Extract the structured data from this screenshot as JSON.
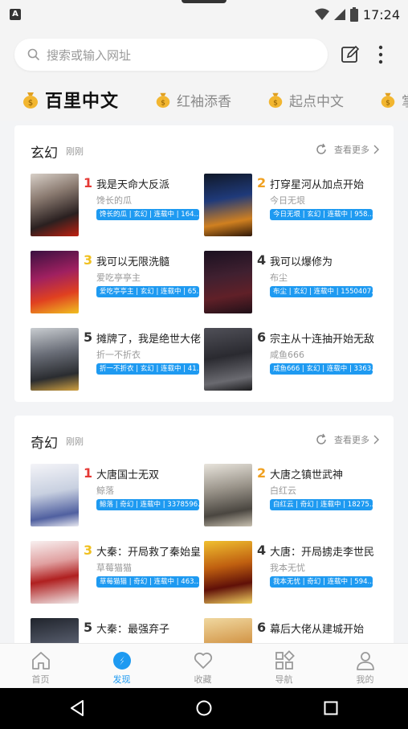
{
  "status": {
    "time": "17:24",
    "app_icon": "A"
  },
  "search": {
    "placeholder": "搜索或输入网址"
  },
  "channels": [
    {
      "label": "百里中文",
      "active": true
    },
    {
      "label": "红袖添香",
      "active": false
    },
    {
      "label": "起点中文",
      "active": false
    },
    {
      "label": "掌",
      "active": false
    }
  ],
  "sections": [
    {
      "title": "玄幻",
      "subtitle": "刚刚",
      "more_label": "查看更多",
      "books": [
        {
          "rank": "1",
          "title": "我是天命大反派",
          "author": "馋长的瓜",
          "tag": "馋长的瓜 | 玄幻 | 连载中 | 164..."
        },
        {
          "rank": "2",
          "title": "打穿星河从加点开始",
          "author": "今日无垠",
          "tag": "今日无垠 | 玄幻 | 连载中 | 958..."
        },
        {
          "rank": "3",
          "title": "我可以无限洗髓",
          "author": "爱吃亭亭主",
          "tag": "爱吃亭亭主 | 玄幻 | 连载中 | 65..."
        },
        {
          "rank": "4",
          "title": "我可以爆修为",
          "author": "布尘",
          "tag": "布尘 | 玄幻 | 连载中 | 1550407..."
        },
        {
          "rank": "5",
          "title": "摊牌了，我是绝世大佬",
          "author": "折一不折衣",
          "tag": "折一不折衣 | 玄幻 | 连载中 | 41..."
        },
        {
          "rank": "6",
          "title": "宗主从十连抽开始无敌",
          "author": "咸鱼666",
          "tag": "咸鱼666 | 玄幻 | 连载中 | 3363..."
        }
      ]
    },
    {
      "title": "奇幻",
      "subtitle": "刚刚",
      "more_label": "查看更多",
      "books": [
        {
          "rank": "1",
          "title": "大唐国士无双",
          "author": "鲸落",
          "tag": "鲸落 | 奇幻 | 连载中 | 3378596..."
        },
        {
          "rank": "2",
          "title": "大唐之镇世武神",
          "author": "白红云",
          "tag": "白红云 | 奇幻 | 连载中 | 18275..."
        },
        {
          "rank": "3",
          "title": "大秦：开局救了秦始皇",
          "author": "草莓猫猫",
          "tag": "草莓猫猫 | 奇幻 | 连载中 | 463..."
        },
        {
          "rank": "4",
          "title": "大唐：开局掳走李世民",
          "author": "我本无忧",
          "tag": "我本无忧 | 奇幻 | 连载中 | 594..."
        },
        {
          "rank": "5",
          "title": "大秦：最强弃子",
          "author": "",
          "tag": ""
        },
        {
          "rank": "6",
          "title": "幕后大佬从建城开始",
          "author": "",
          "tag": ""
        }
      ]
    }
  ],
  "nav": [
    {
      "label": "首页",
      "icon": "home-icon"
    },
    {
      "label": "发现",
      "icon": "discover-icon"
    },
    {
      "label": "收藏",
      "icon": "heart-icon"
    },
    {
      "label": "导航",
      "icon": "grid-icon"
    },
    {
      "label": "我的",
      "icon": "user-icon"
    }
  ],
  "colors": {
    "accent": "#1e9af1",
    "rank1": "#e53935",
    "rank2": "#f0a020",
    "rank3": "#f0c020",
    "rank_other": "#333333"
  }
}
